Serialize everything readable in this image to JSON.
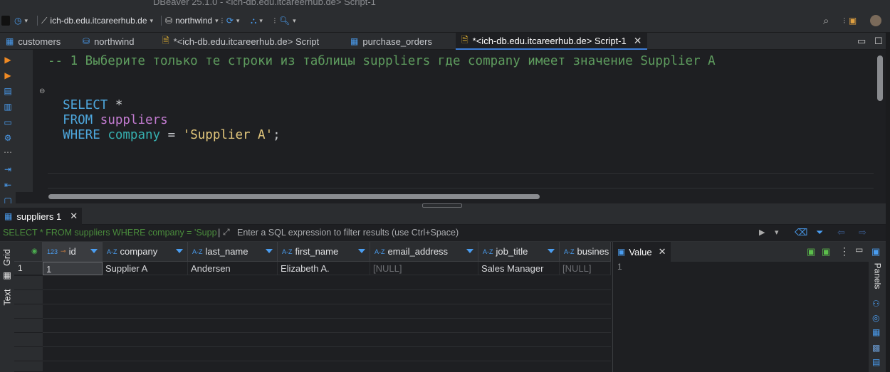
{
  "window": {
    "title": "DBeaver 25.1.0 - <ich-db.edu.itcareerhub.de> Script-1"
  },
  "toolbar": {
    "connection": "ich-db.edu.itcareerhub.de",
    "database": "northwind"
  },
  "tabs": [
    {
      "label": "customers",
      "icon": "table-icon"
    },
    {
      "label": "northwind",
      "icon": "database-icon"
    },
    {
      "label": "*<ich-db.edu.itcareerhub.de> Script",
      "icon": "sql-script-icon"
    },
    {
      "label": "purchase_orders",
      "icon": "table-icon"
    },
    {
      "label": "*<ich-db.edu.itcareerhub.de> Script-1",
      "icon": "sql-script-icon",
      "active": true
    }
  ],
  "editor": {
    "comment": "-- 1 Выберите только те строки из таблицы suppliers где company имеет значение Supplier A",
    "kw_select": "SELECT",
    "star": " *",
    "kw_from": "FROM",
    "table": "suppliers",
    "kw_where": "WHERE",
    "column": "company",
    "op": " = ",
    "string": "'Supplier A'",
    "semicolon": ";"
  },
  "results": {
    "tab_label": "suppliers 1",
    "query": "SELECT * FROM suppliers WHERE company = 'Supplier A'",
    "filter_placeholder": "Enter a SQL expression to filter results (use Ctrl+Space)",
    "side_tabs": [
      "Grid",
      "Text"
    ],
    "columns": [
      {
        "type": "123",
        "name": "id"
      },
      {
        "type": "A-Z",
        "name": "company"
      },
      {
        "type": "A-Z",
        "name": "last_name"
      },
      {
        "type": "A-Z",
        "name": "first_name"
      },
      {
        "type": "A-Z",
        "name": "email_address"
      },
      {
        "type": "A-Z",
        "name": "job_title"
      },
      {
        "type": "A-Z",
        "name": "busines"
      }
    ],
    "rows": [
      {
        "num": "1",
        "cells": [
          "1",
          "Supplier A",
          "Andersen",
          "Elizabeth A.",
          "[NULL]",
          "Sales Manager",
          "[NULL]"
        ]
      }
    ]
  },
  "value_panel": {
    "title": "Value",
    "value": "1"
  },
  "right_panel": {
    "label": "Panels"
  },
  "colors": {
    "keyword": "#4ea7dd",
    "table": "#c27bd0",
    "column": "#36b0b0",
    "string": "#e3c77c",
    "comment": "#5e9c5e",
    "accent": "#3d7dd8"
  }
}
